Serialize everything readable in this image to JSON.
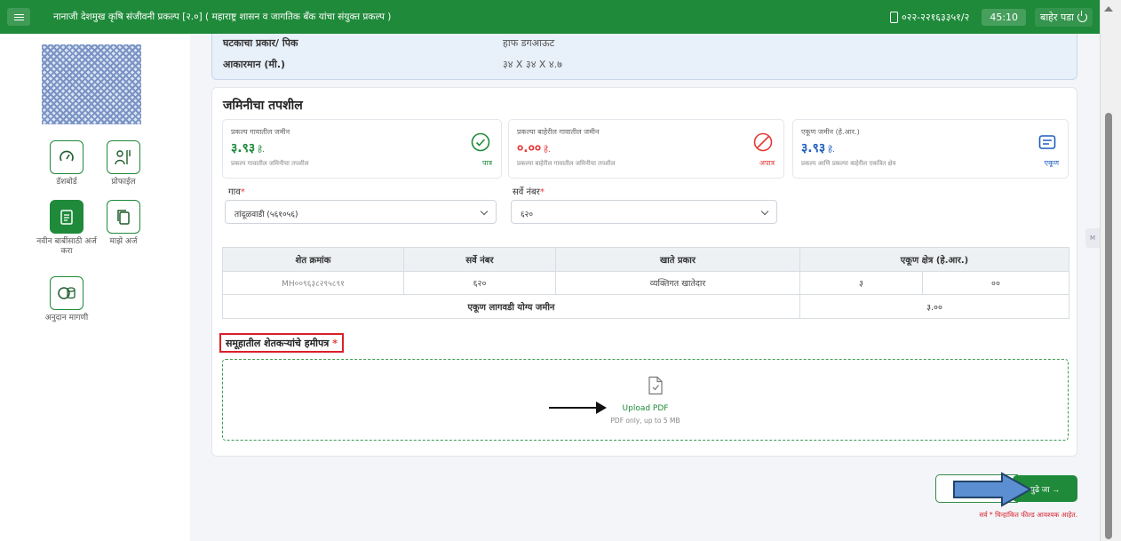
{
  "header": {
    "title": "नानाजी देशमुख कृषि संजीवनी प्रकल्प [२.०] ( महाराष्ट्र शासन व जागतिक बँक यांचा संयुक्त प्रकल्प )",
    "phone": "०२२-२२१६३३५१/२",
    "timer": "45:10",
    "logout": "बाहेर पडा"
  },
  "sidebar": {
    "items": [
      {
        "label": "डॅशबोर्ड"
      },
      {
        "label": "प्रोफाईल"
      },
      {
        "label": "नवीन बाबींसाठी अर्ज करा"
      },
      {
        "label": "माझे अर्ज"
      },
      {
        "label": "अनुदान मागणी"
      }
    ]
  },
  "summary": {
    "rows": [
      {
        "label": "घटकाचा प्रकार/ पिक",
        "value": "हाफ डगआऊट"
      },
      {
        "label": "आकारमान (मी.)",
        "value": "३४ X ३४ X ४.७"
      }
    ]
  },
  "land": {
    "title": "जमिनीचा तपशील",
    "stats": [
      {
        "label": "प्रकल्प गावातील जमीन",
        "value": "३.९३",
        "unit": "हे.",
        "desc": "प्रकल्प गावातील जमिनीचा तपशील",
        "tag": "पात्र",
        "color": "#1f8a3a",
        "icon": "check-circle-icon"
      },
      {
        "label": "प्रकल्पा बाहेरील गावातील जमीन",
        "value": "०.००",
        "unit": "हे.",
        "desc": "प्रकल्पा बाहेरील गावातील जमिनीचा तपशील",
        "tag": "अपात्र",
        "color": "#e53935",
        "icon": "ban-icon"
      },
      {
        "label": "एकूण जमीन (हे.आर.)",
        "value": "३.९३",
        "unit": "हे.",
        "desc": "प्रकल्प आणि प्रकल्पा बाहेरील एकत्रित क्षेत्र",
        "tag": "एकूण",
        "color": "#1f5fbf",
        "icon": "list-card-icon"
      }
    ],
    "village_label": "गाव",
    "village_value": "तांदूळवाडी (५६१०५६)",
    "survey_label": "सर्वे नंबर",
    "survey_value": "६२०",
    "table": {
      "headers": [
        "शेत क्रमांक",
        "सर्वे नंबर",
        "खाते प्रकार",
        "एकूण क्षेत्र (हे.आर.)"
      ],
      "row": {
        "farm_no": "MH००९६३८२९५८९१",
        "survey": "६२०",
        "account_type": "व्यक्तिगत खातेदार",
        "hectare": "३",
        "are": "००"
      },
      "footer_label": "एकूण लागवडी योग्य जमीन",
      "footer_value": "३.००"
    },
    "document_label": "समूहातील शेतकऱ्यांचे हमीपत्र",
    "upload_label": "Upload PDF",
    "upload_hint": "PDF only, up to 5 MB"
  },
  "actions": {
    "next_label": "पुढे जा →",
    "required_note": "सर्व * चिन्हांकित फील्ड आवश्यक आहेत."
  },
  "colors": {
    "brand": "#1f8a3a",
    "danger": "#e53935",
    "info": "#1f5fbf"
  }
}
